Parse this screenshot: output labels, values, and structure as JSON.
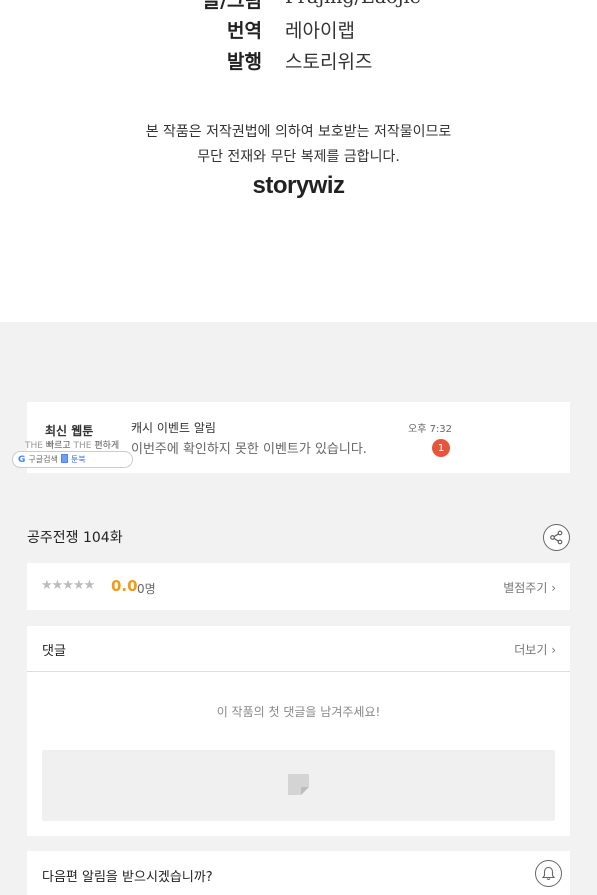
{
  "credits": {
    "rows": [
      {
        "key": "글/그림",
        "value": "Prajing/Eaojie"
      },
      {
        "key": "번역",
        "value": "레아이랩"
      },
      {
        "key": "발행",
        "value": "스토리위즈"
      }
    ],
    "notice_line1": "본 작품은 저작권법에 의하여 보호받는 저작물이므로",
    "notice_line2": "무단 전재와 무단 복제를 금합니다.",
    "publisher_logo": "storywiz"
  },
  "notification": {
    "app_title": "최신 웹툰",
    "app_sub_the1": "THE",
    "app_sub_fast": "빠르고",
    "app_sub_the2": "THE",
    "app_sub_easy": "편하게",
    "app_pill_google": "G",
    "app_pill_search": "구글검색",
    "app_pill_book_icon": "book-icon",
    "app_pill_book": "툰북",
    "title": "캐시 이벤트 알림",
    "message": "이번주에 확인하지 못한 이벤트가 있습니다.",
    "time": "오후 7:32",
    "badge": "1"
  },
  "episode": {
    "title": "공주전쟁 104화",
    "share_icon": "share-icon"
  },
  "rating": {
    "stars": "★★★★★",
    "stars_value": 0,
    "score": "0.0",
    "count": "0명",
    "rate_link": "별점주기 ›"
  },
  "comments": {
    "label": "댓글",
    "more_link": "더보기 ›",
    "empty_message": "이 작품의 첫 댓글을 남겨주세요!",
    "input_icon": "comment-icon"
  },
  "next_episode": {
    "label": "다음편 알림을 받으시겠습니까?",
    "bell_icon": "bell-icon"
  },
  "colors": {
    "accent_score": "#f39c12",
    "badge": "#e8553c",
    "background": "#f2f2f2"
  }
}
